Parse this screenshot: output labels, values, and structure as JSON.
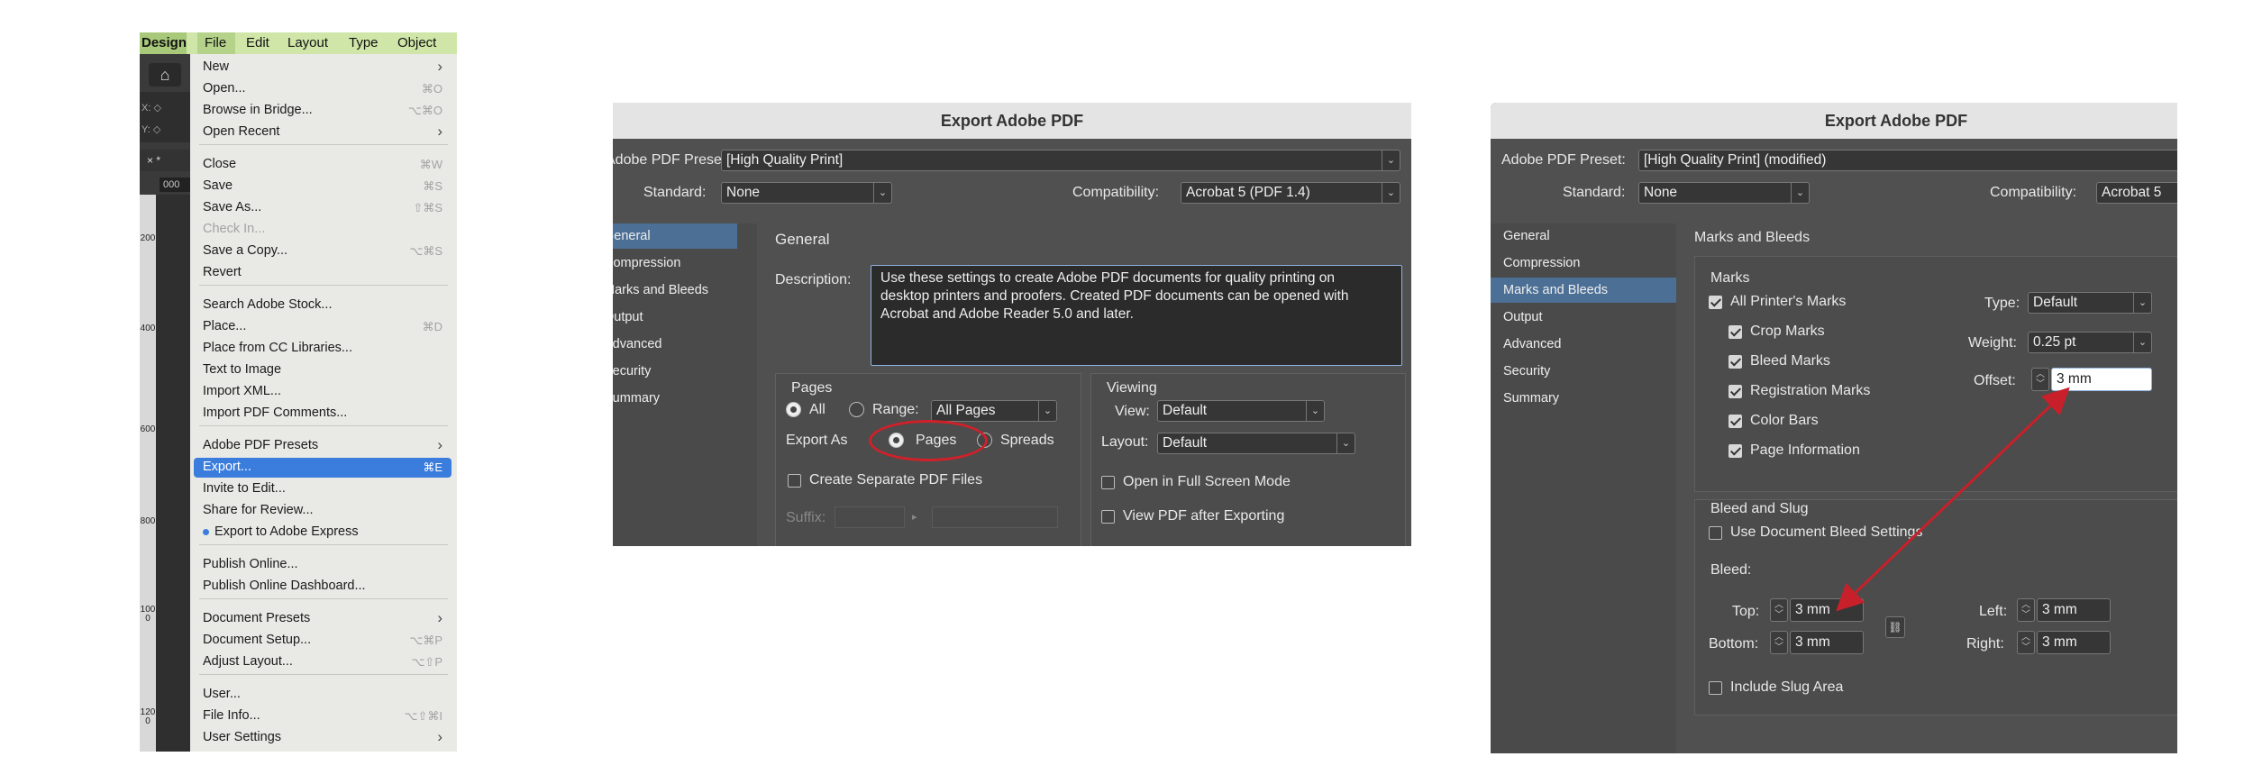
{
  "file_menu": {
    "menubar": [
      "Design",
      "File",
      "Edit",
      "Layout",
      "Type",
      "Object"
    ],
    "ruler_labels": [
      "200",
      "400",
      "600",
      "800",
      "1000",
      "1200"
    ],
    "tab_label": "×  *",
    "field_value": "000",
    "items": [
      {
        "label": "New",
        "shortcut": "",
        "submenu": true
      },
      {
        "label": "Open...",
        "shortcut": "⌘O"
      },
      {
        "label": "Browse in Bridge...",
        "shortcut": "⌥⌘O"
      },
      {
        "label": "Open Recent",
        "shortcut": "",
        "submenu": true
      },
      {
        "label": "Close",
        "shortcut": "⌘W"
      },
      {
        "label": "Save",
        "shortcut": "⌘S"
      },
      {
        "label": "Save As...",
        "shortcut": "⇧⌘S"
      },
      {
        "label": "Check In...",
        "shortcut": "",
        "disabled": true
      },
      {
        "label": "Save a Copy...",
        "shortcut": "⌥⌘S"
      },
      {
        "label": "Revert",
        "shortcut": ""
      },
      {
        "label": "Search Adobe Stock...",
        "shortcut": ""
      },
      {
        "label": "Place...",
        "shortcut": "⌘D"
      },
      {
        "label": "Place from CC Libraries...",
        "shortcut": ""
      },
      {
        "label": "Text to Image",
        "shortcut": ""
      },
      {
        "label": "Import XML...",
        "shortcut": ""
      },
      {
        "label": "Import PDF Comments...",
        "shortcut": ""
      },
      {
        "label": "Adobe PDF Presets",
        "shortcut": "",
        "submenu": true
      },
      {
        "label": "Export...",
        "shortcut": "⌘E",
        "highlight": true
      },
      {
        "label": "Invite to Edit...",
        "shortcut": ""
      },
      {
        "label": "Share for Review...",
        "shortcut": ""
      },
      {
        "label": "Export to Adobe Express",
        "shortcut": "",
        "dot": true
      },
      {
        "label": "Publish Online...",
        "shortcut": ""
      },
      {
        "label": "Publish Online Dashboard...",
        "shortcut": ""
      },
      {
        "label": "Document Presets",
        "shortcut": "",
        "submenu": true
      },
      {
        "label": "Document Setup...",
        "shortcut": "⌥⌘P"
      },
      {
        "label": "Adjust Layout...",
        "shortcut": "⌥⇧P"
      },
      {
        "label": "User...",
        "shortcut": ""
      },
      {
        "label": "File Info...",
        "shortcut": "⌥⇧⌘I"
      },
      {
        "label": "User Settings",
        "shortcut": "",
        "submenu": true
      }
    ]
  },
  "dialog_general": {
    "title": "Export Adobe PDF",
    "preset_label": "Adobe PDF Preset:",
    "preset_value": "[High Quality Print]",
    "standard_label": "Standard:",
    "standard_value": "None",
    "compat_label": "Compatibility:",
    "compat_value": "Acrobat 5 (PDF 1.4)",
    "nav": [
      "General",
      "Compression",
      "Marks and Bleeds",
      "Output",
      "Advanced",
      "Security",
      "Summary"
    ],
    "section_title": "General",
    "description_label": "Description:",
    "description": "Use these settings to create Adobe PDF documents for quality printing on desktop printers and proofers.  Created PDF documents can be opened with Acrobat and Adobe Reader 5.0 and later.",
    "pages": {
      "title": "Pages",
      "all": "All",
      "range": "Range:",
      "range_value": "All Pages",
      "export_as": "Export As",
      "pages_opt": "Pages",
      "spreads_opt": "Spreads",
      "separate": "Create Separate PDF Files",
      "suffix": "Suffix:"
    },
    "viewing": {
      "title": "Viewing",
      "view_label": "View:",
      "view_value": "Default",
      "layout_label": "Layout:",
      "layout_value": "Default",
      "fullscreen": "Open in Full Screen Mode",
      "after_export": "View PDF after Exporting"
    },
    "highlight_color": "#d0202a"
  },
  "dialog_marks": {
    "title": "Export Adobe PDF",
    "preset_label": "Adobe PDF Preset:",
    "preset_value": "[High Quality Print] (modified)",
    "standard_label": "Standard:",
    "standard_value": "None",
    "compat_label": "Compatibility:",
    "compat_value": "Acrobat 5",
    "nav": [
      "General",
      "Compression",
      "Marks and Bleeds",
      "Output",
      "Advanced",
      "Security",
      "Summary"
    ],
    "section_title": "Marks and Bleeds",
    "marks": {
      "title": "Marks",
      "all": "All Printer's Marks",
      "items": [
        "Crop Marks",
        "Bleed Marks",
        "Registration Marks",
        "Color Bars",
        "Page Information"
      ],
      "type_label": "Type:",
      "type_value": "Default",
      "weight_label": "Weight:",
      "weight_value": "0.25 pt",
      "offset_label": "Offset:",
      "offset_value": "3 mm"
    },
    "bleed": {
      "title": "Bleed and Slug",
      "use_doc": "Use Document Bleed Settings",
      "bleed_label": "Bleed:",
      "top_label": "Top:",
      "top_value": "3 mm",
      "bottom_label": "Bottom:",
      "bottom_value": "3 mm",
      "left_label": "Left:",
      "left_value": "3 mm",
      "right_label": "Right:",
      "right_value": "3 mm",
      "slug": "Include Slug Area"
    },
    "arrow_color": "#c8202a"
  }
}
